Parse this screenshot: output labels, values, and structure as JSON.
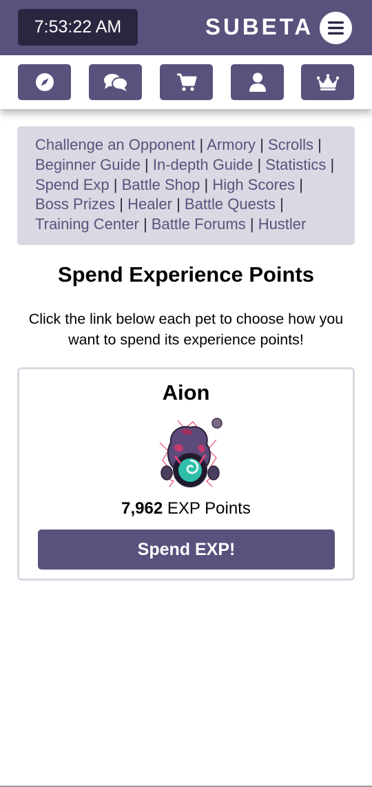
{
  "header": {
    "clock": "7:53:22 AM",
    "brand": "SUBETA"
  },
  "nav": {
    "icons": [
      "compass-icon",
      "chat-bubbles-icon",
      "shopping-cart-icon",
      "user-icon",
      "crown-icon"
    ]
  },
  "battle_links": [
    "Challenge an Opponent",
    "Armory",
    "Scrolls",
    "Beginner Guide",
    "In-depth Guide",
    "Statistics",
    "Spend Exp",
    "Battle Shop",
    "High Scores",
    "Boss Prizes",
    "Healer",
    "Battle Quests",
    "Training Center",
    "Battle Forums",
    "Hustler"
  ],
  "separator": "|",
  "page": {
    "title": "Spend Experience Points",
    "intro": "Click the link below each pet to choose how you want to spend its experience points!"
  },
  "pet": {
    "name": "Aion",
    "exp_value": "7,962",
    "exp_label": "EXP Points",
    "button_label": "Spend EXP!"
  },
  "colors": {
    "primary": "#59527d",
    "dark": "#2a2640",
    "panel": "#dad8e2"
  }
}
